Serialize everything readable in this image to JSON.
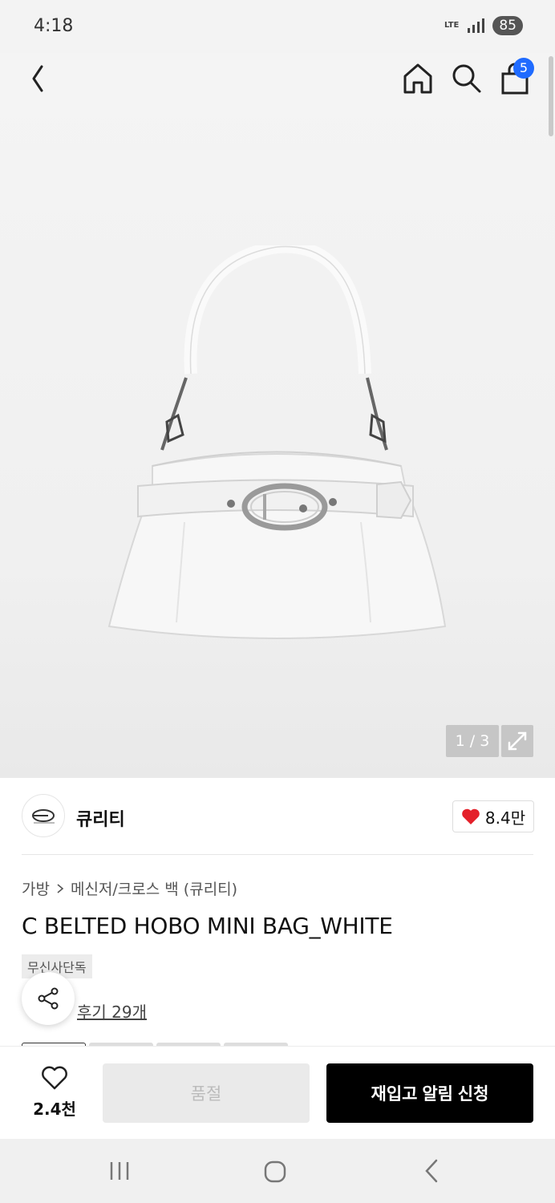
{
  "status_bar": {
    "time": "4:18",
    "network": "LTE",
    "battery": "85"
  },
  "header": {
    "cart_count": "5"
  },
  "gallery": {
    "indicator": "1 / 3"
  },
  "brand": {
    "name": "큐리티",
    "likes": "8.4만"
  },
  "breadcrumb": {
    "category": "가방",
    "subcategory": "메신저/크로스 백 (큐리티)"
  },
  "product": {
    "title": "C BELTED HOBO MINI BAG_WHITE",
    "badge": "무신사단독",
    "review_link": "후기 29개"
  },
  "actions": {
    "wish_count": "2.4천",
    "soldout_label": "품절",
    "restock_label": "재입고 알림 신청"
  },
  "colors": {
    "accent_blue": "#1f6bff",
    "like_red": "#e4202a",
    "primary_black": "#000000"
  }
}
